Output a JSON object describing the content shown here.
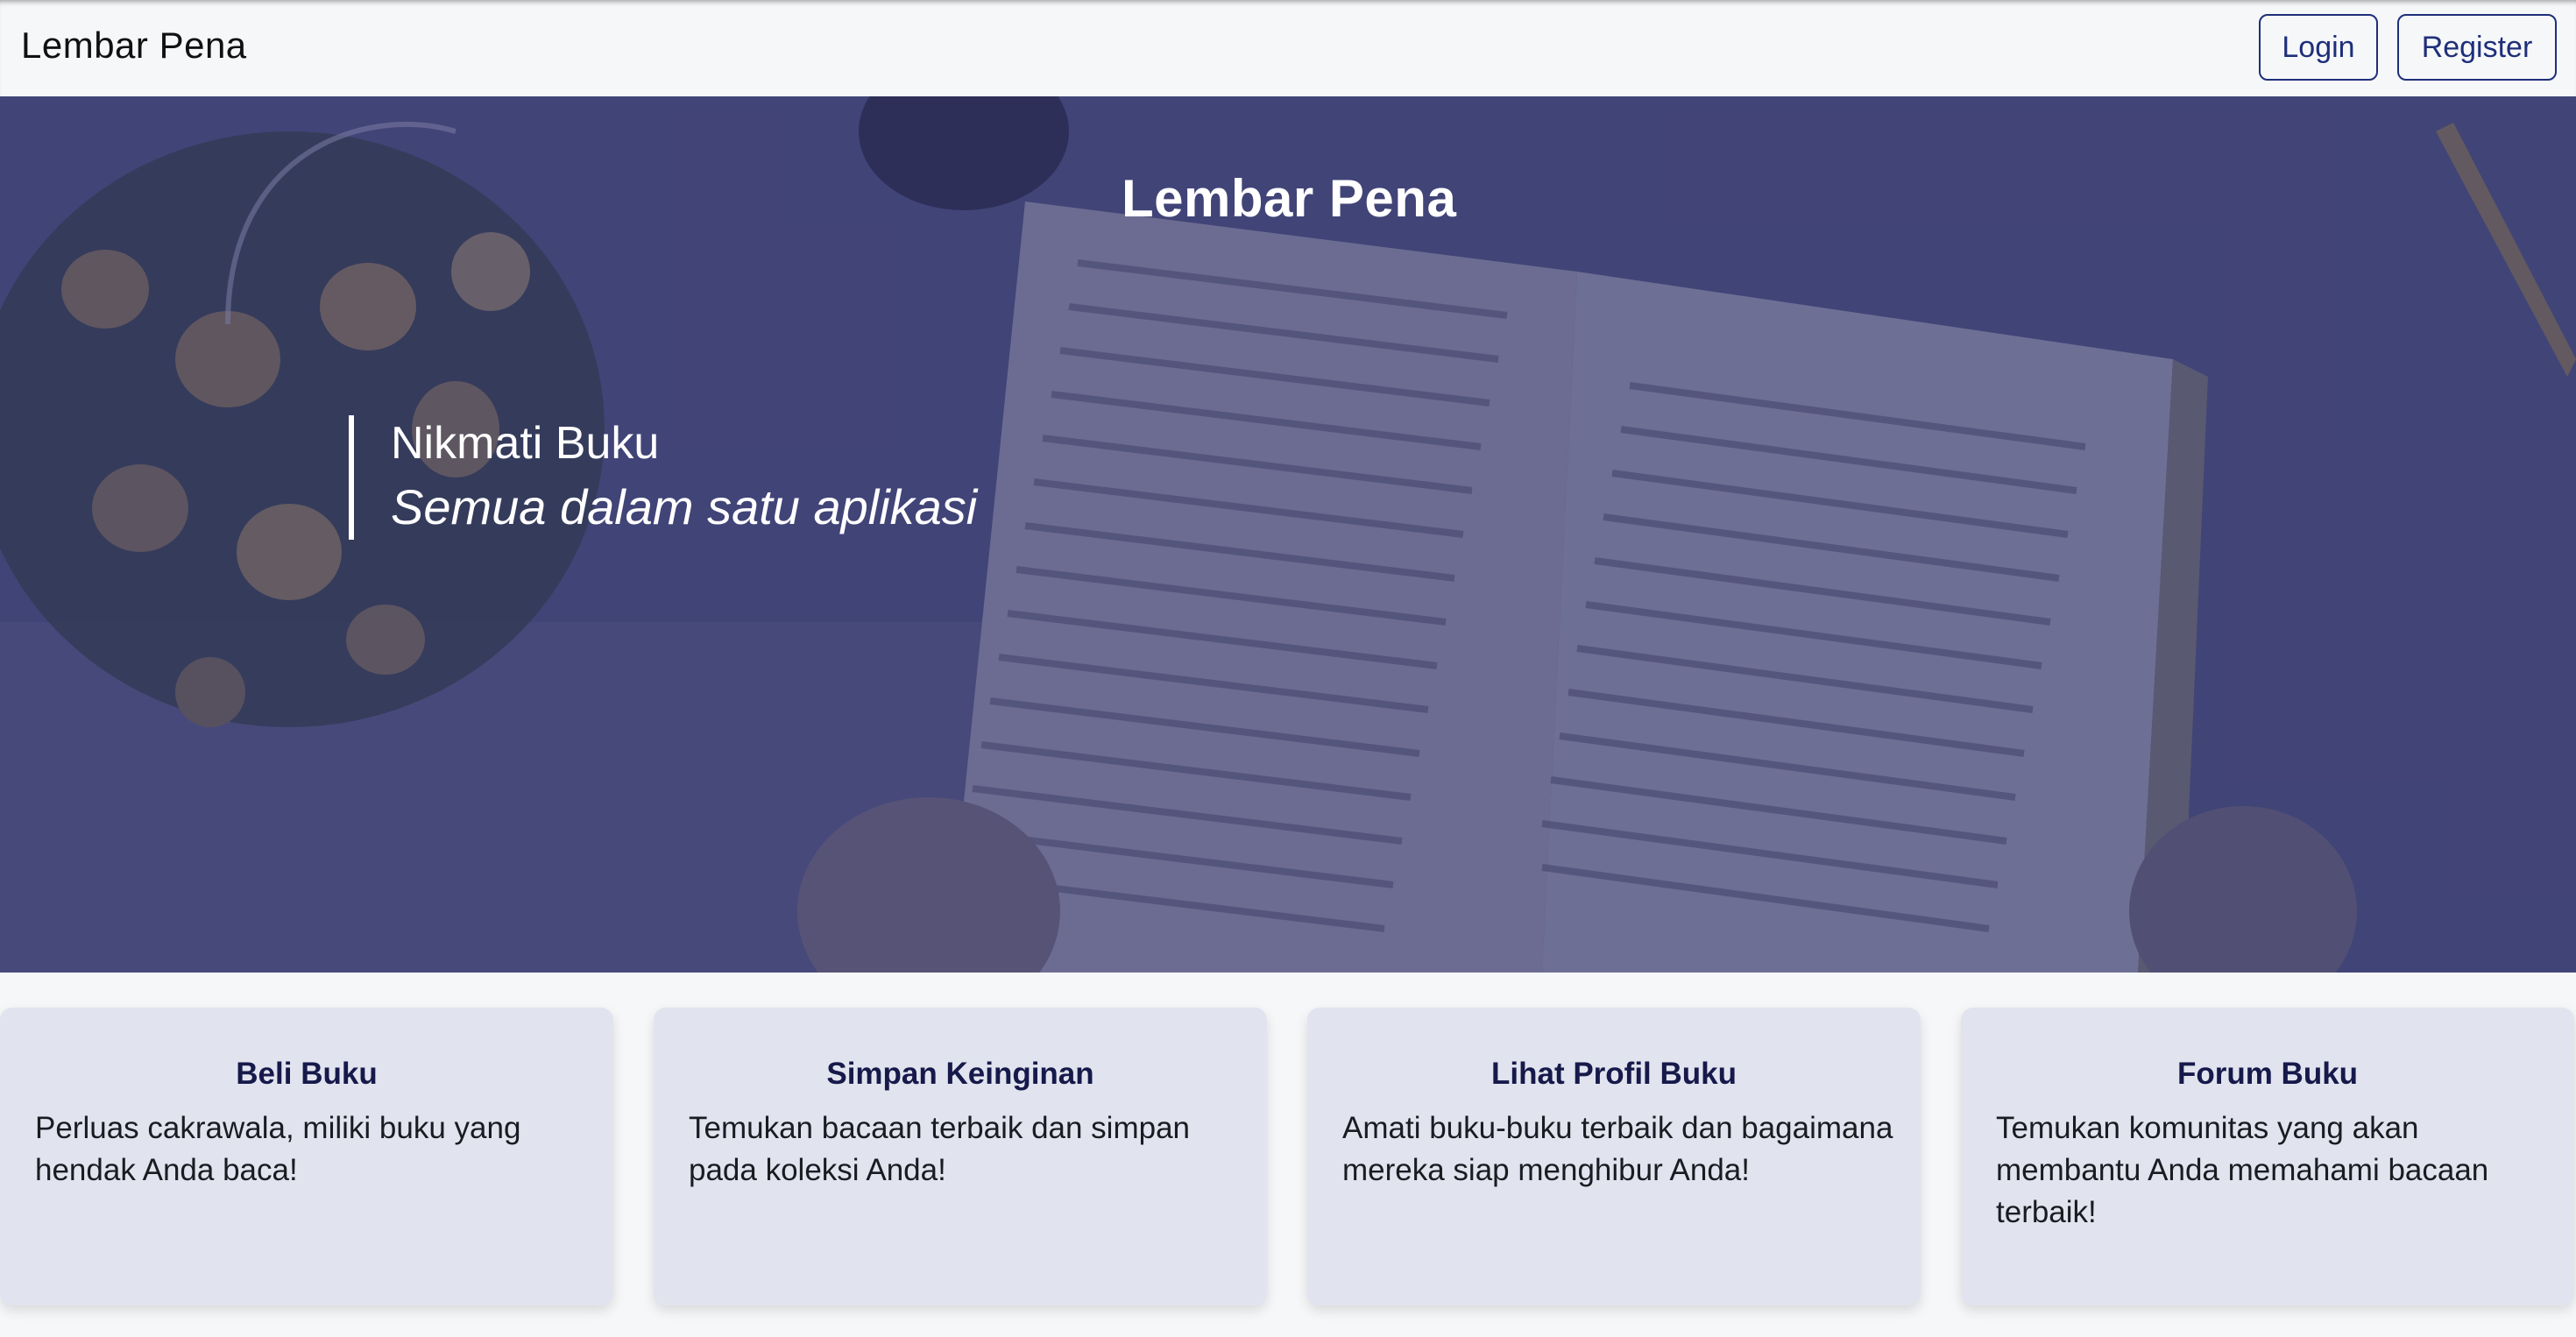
{
  "navbar": {
    "brand": "Lembar Pena",
    "login_label": "Login",
    "register_label": "Register"
  },
  "hero": {
    "title": "Lembar Pena",
    "tagline_line1": "Nikmati Buku",
    "tagline_line2": "Semua dalam satu aplikasi"
  },
  "features": [
    {
      "title": "Beli Buku",
      "text": "Perluas cakrawala, miliki buku yang hendak Anda baca!"
    },
    {
      "title": "Simpan Keinginan",
      "text": "Temukan bacaan terbaik dan simpan pada koleksi Anda!"
    },
    {
      "title": "Lihat Profil Buku",
      "text": "Amati buku-buku terbaik dan bagaimana mereka siap menghibur Anda!"
    },
    {
      "title": "Forum Buku",
      "text": "Temukan komunitas yang akan membantu Anda memahami bacaan terbaik!"
    }
  ],
  "colors": {
    "accent": "#1e2f7a",
    "hero_overlay": "#2e3069",
    "card_bg": "#e1e4ee",
    "card_title": "#16194a"
  }
}
